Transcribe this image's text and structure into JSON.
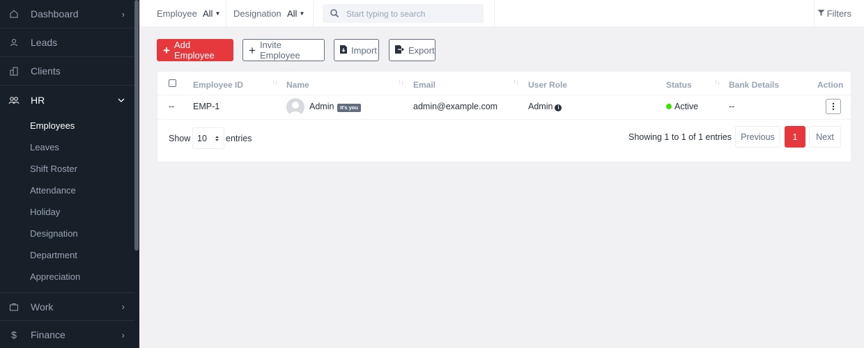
{
  "sidebar": {
    "items": [
      {
        "label": "Dashboard",
        "icon": "home-icon"
      },
      {
        "label": "Leads",
        "icon": "user-icon"
      },
      {
        "label": "Clients",
        "icon": "building-icon"
      },
      {
        "label": "HR",
        "icon": "people-icon"
      },
      {
        "label": "Work",
        "icon": "briefcase-icon"
      },
      {
        "label": "Finance",
        "icon": "dollar-icon"
      }
    ],
    "hr_submenu": [
      "Employees",
      "Leaves",
      "Shift Roster",
      "Attendance",
      "Holiday",
      "Designation",
      "Department",
      "Appreciation"
    ]
  },
  "topbar": {
    "employee_label": "Employee",
    "employee_value": "All",
    "designation_label": "Designation",
    "designation_value": "All",
    "search_placeholder": "Start typing to search",
    "filters_label": "Filters"
  },
  "actions": {
    "add": "Add Employee",
    "invite": "Invite Employee",
    "import": "Import",
    "export": "Export"
  },
  "table": {
    "columns": [
      "Employee ID",
      "Name",
      "Email",
      "User Role",
      "Status",
      "Bank Details",
      "Action"
    ],
    "rows": [
      {
        "check": "--",
        "employee_id": "EMP-1",
        "name": "Admin",
        "badge": "It's you",
        "email": "admin@example.com",
        "role": "Admin",
        "status": "Active",
        "bank": "--"
      }
    ]
  },
  "footer": {
    "show": "Show",
    "entries_value": "10",
    "entries": "entries",
    "showing": "Showing 1 to 1 of 1 entries",
    "previous": "Previous",
    "page": "1",
    "next": "Next"
  },
  "colors": {
    "accent": "#e6393e",
    "sidebar_bg": "#171f29",
    "status_active": "#39e500"
  }
}
